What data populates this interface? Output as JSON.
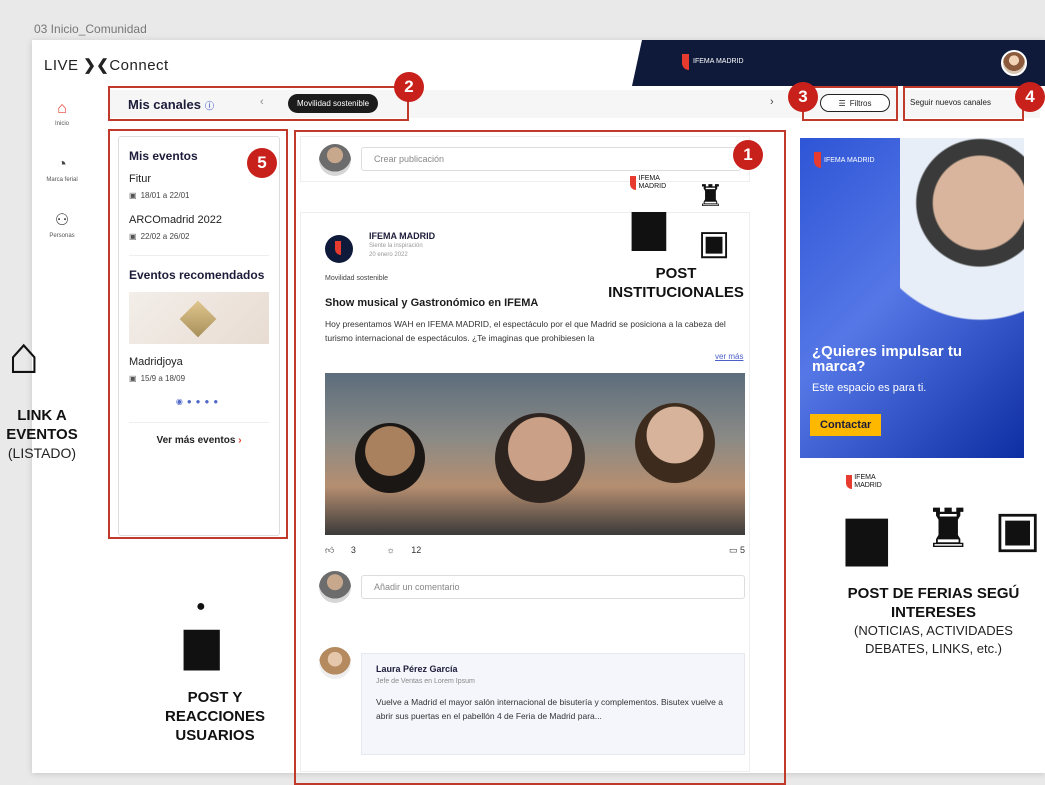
{
  "frame_label": "03 Inicio_Comunidad",
  "header": {
    "logo_left": "LIVE",
    "logo_right": "Connect",
    "brand": "IFEMA MADRID"
  },
  "nav": [
    {
      "label": "Inicio",
      "icon": "home-icon"
    },
    {
      "label": "Marca ferial",
      "icon": "palette-icon"
    },
    {
      "label": "Personas",
      "icon": "people-icon"
    }
  ],
  "channels": {
    "title": "Mis canales",
    "chip": "Movilidad sostenible",
    "filter_label": "Filtros",
    "follow_label": "Seguir nuevos canales"
  },
  "events": {
    "title": "Mis eventos",
    "items": [
      {
        "name": "Fitur",
        "date": "18/01 a 22/01"
      },
      {
        "name": "ARCOmadrid 2022",
        "date": "22/02 a 26/02"
      }
    ],
    "recommended_title": "Eventos recomendados",
    "recommended": {
      "name": "Madridjoya",
      "date": "15/9 a 18/09"
    },
    "see_more": "Ver más eventos"
  },
  "feed": {
    "create_placeholder": "Crear publicación",
    "post": {
      "author": "IFEMA MADRID",
      "tagline": "Siente la inspiración",
      "date": "20 enero 2022",
      "category": "Movilidad sostenible",
      "title": "Show musical y Gastronómico en IFEMA",
      "body": "Hoy presentamos WAH en IFEMA MADRID, el espectáculo por el que Madrid se posiciona a la cabeza del turismo internacional de espectáculos. ¿Te imaginas que prohibiesen la",
      "read_more": "ver más",
      "likes": "3",
      "claps": "12",
      "comments": "5",
      "comment_placeholder": "Añadir un comentario"
    },
    "comment": {
      "name": "Laura Pérez García",
      "role": "Jefe de Ventas en Lorem Ipsum",
      "text": "Vuelve a Madrid el mayor salón internacional de bisutería y complementos. Bisutex vuelve a abrir sus puertas en el pabellón 4 de Feria de Madrid para..."
    }
  },
  "ad": {
    "brand": "IFEMA MADRID",
    "headline": "¿Quieres impulsar tu marca?",
    "sub": "Este espacio es para ti.",
    "cta": "Contactar"
  },
  "annotations": {
    "badges": [
      "1",
      "2",
      "3",
      "4",
      "5"
    ],
    "post_inst_l1": "POST",
    "post_inst_l2": "INSTITUCIONALES",
    "brand_small": "IFEMA MADRID",
    "link_l1": "LINK A",
    "link_l2": "EVENTOS",
    "link_l3": "(LISTADO)",
    "post_user_l1": "POST Y",
    "post_user_l2": "REACCIONES",
    "post_user_l3": "USUARIOS",
    "fair_l1": "POST DE FERIAS SEGÚ",
    "fair_l2": "INTERESES",
    "fair_l3": "(NOTICIAS, ACTIVIDADES",
    "fair_l4": "DEBATES, LINKS, etc.)"
  }
}
